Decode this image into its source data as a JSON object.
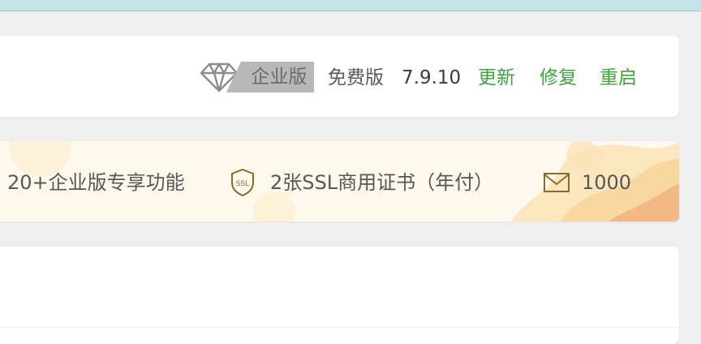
{
  "version_bar": {
    "edition_badge": "企业版",
    "free_label": "免费版",
    "version": "7.9.10",
    "actions": {
      "update": "更新",
      "repair": "修复",
      "restart": "重启"
    },
    "icons": [
      "diamond-icon"
    ]
  },
  "promo_bar": {
    "feature_text": "20+企业版专享功能",
    "ssl_text": "2张SSL商用证书（年付）",
    "mail_count": "1000",
    "icons": [
      "ssl-icon",
      "mail-icon"
    ]
  },
  "colors": {
    "action_green": "#3fa13f",
    "badge_gray": "#b8b8b8",
    "promo_bg": "#fef9ec",
    "icon_gold": "#8a6a2a",
    "top_strip": "#c3e3e6"
  }
}
